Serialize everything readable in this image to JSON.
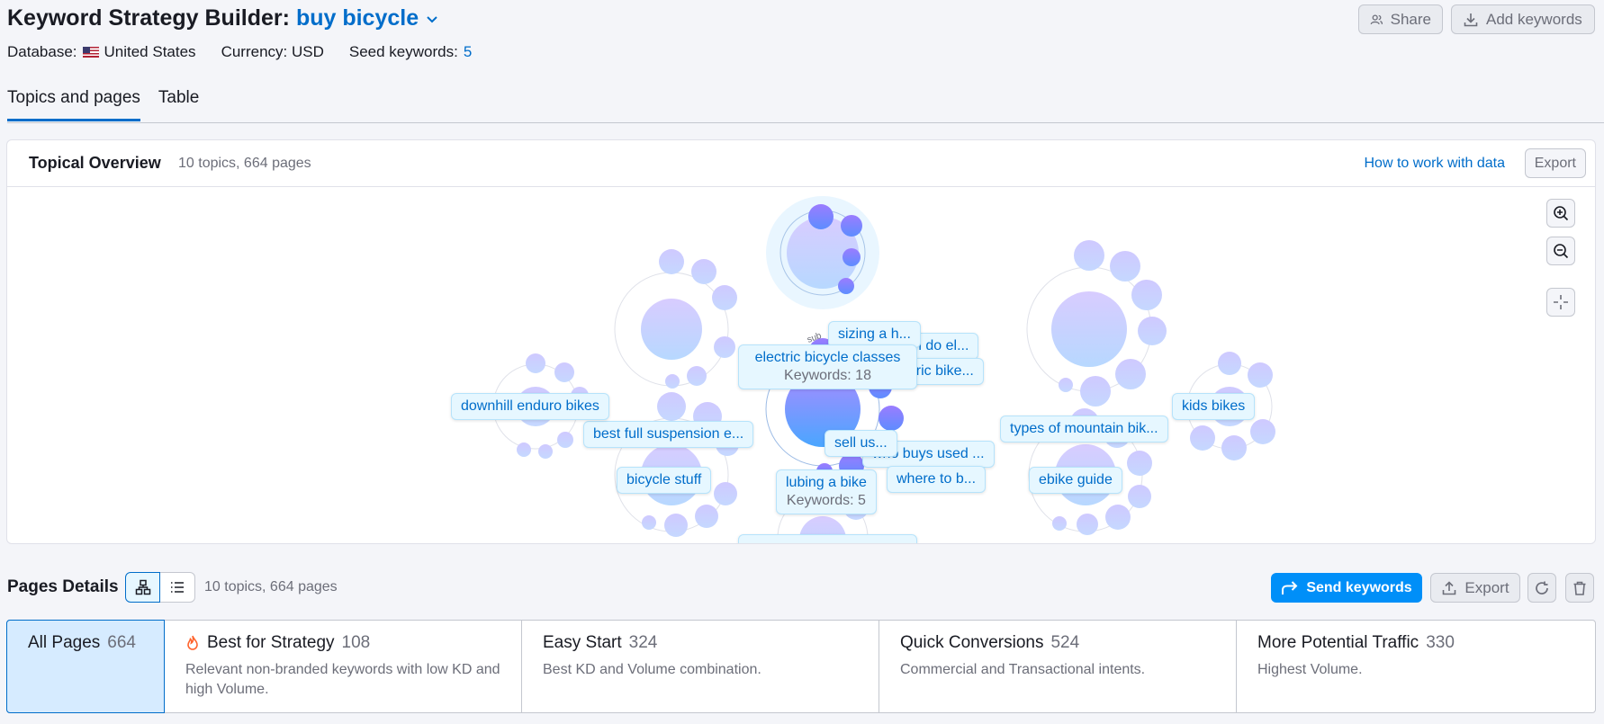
{
  "header": {
    "title": "Keyword Strategy Builder:",
    "keyword": "buy bicycle",
    "database_label": "Database:",
    "database_value": "United States",
    "currency": "Currency: USD",
    "seed_label": "Seed keywords:",
    "seed_value": "5",
    "share_label": "Share",
    "add_keywords_label": "Add keywords"
  },
  "tabs": [
    {
      "label": "Topics and pages",
      "active": true
    },
    {
      "label": "Table",
      "active": false
    }
  ],
  "overview": {
    "title": "Topical Overview",
    "subtitle": "10 topics, 664 pages",
    "how_to": "How to work with data",
    "export": "Export",
    "arc_labels": {
      "topic": "topic",
      "pillar": "pillar",
      "sub": "sub"
    },
    "labels": [
      {
        "text": "sizing a h...",
        "sub": ""
      },
      {
        "text": "how much do el...",
        "sub": ""
      },
      {
        "text": "electric bike...",
        "sub": ""
      },
      {
        "text": "electric bicycle classes",
        "sub": "Keywords: 18"
      },
      {
        "text": "best full suspension e...",
        "sub": ""
      },
      {
        "text": "types of mountain bik...",
        "sub": ""
      },
      {
        "text": "sell us...",
        "sub": ""
      },
      {
        "text": "who buys used ...",
        "sub": ""
      },
      {
        "text": "where to b...",
        "sub": ""
      },
      {
        "text": "lubing a bike",
        "sub": "Keywords: 5"
      },
      {
        "text": "downhill enduro bikes",
        "sub": ""
      },
      {
        "text": "kids bikes",
        "sub": ""
      },
      {
        "text": "bicycle stuff",
        "sub": ""
      },
      {
        "text": "ebike guide",
        "sub": ""
      }
    ]
  },
  "pages_details": {
    "title": "Pages Details",
    "subtitle": "10 topics, 664 pages",
    "send_keywords": "Send keywords",
    "export": "Export",
    "cards": [
      {
        "title": "All Pages",
        "count": "664",
        "desc": "",
        "active": true
      },
      {
        "title": "Best for Strategy",
        "count": "108",
        "desc": "Relevant non-branded keywords with low KD and high Volume.",
        "active": false
      },
      {
        "title": "Easy Start",
        "count": "324",
        "desc": "Best KD and Volume combination.",
        "active": false
      },
      {
        "title": "Quick Conversions",
        "count": "524",
        "desc": "Commercial and Transactional intents.",
        "active": false
      },
      {
        "title": "More Potential Traffic",
        "count": "330",
        "desc": "Highest Volume.",
        "active": false
      }
    ]
  },
  "colors": {
    "accent": "#006dca",
    "primary_button": "#008ff8",
    "fire": "#ff642d"
  }
}
